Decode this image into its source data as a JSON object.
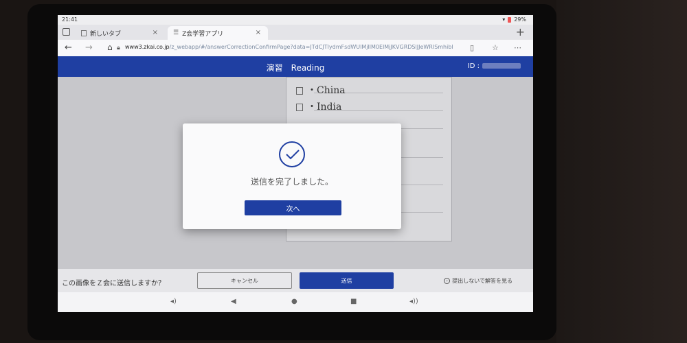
{
  "status": {
    "time": "21:41",
    "battery": "29%"
  },
  "tabs": [
    {
      "label": "新しいタブ",
      "close": "×"
    },
    {
      "label": "Z会学習アプリ",
      "close": "×"
    }
  ],
  "new_tab": "+",
  "address": {
    "host": "www3.zkai.co.jp",
    "path": "/z_webapp/#/answerCorrectionConfirmPage?data=JTdCJTIydmFsdWUlMjIlM0ElMjJKVGRDSlJJeWRISmhibl"
  },
  "header": {
    "title": "演習　Reading",
    "id_label": "ID :"
  },
  "worksheet": {
    "entries": [
      "China",
      "India"
    ]
  },
  "dialog": {
    "message": "送信を完了しました。",
    "next_label": "次へ"
  },
  "bottom": {
    "question": "この画像をＺ会に送信しますか？",
    "cancel_label": "キャンセル",
    "send_label": "送信",
    "answer_link": "提出しないで解答を見る"
  },
  "colors": {
    "accent": "#1f3fa2"
  }
}
